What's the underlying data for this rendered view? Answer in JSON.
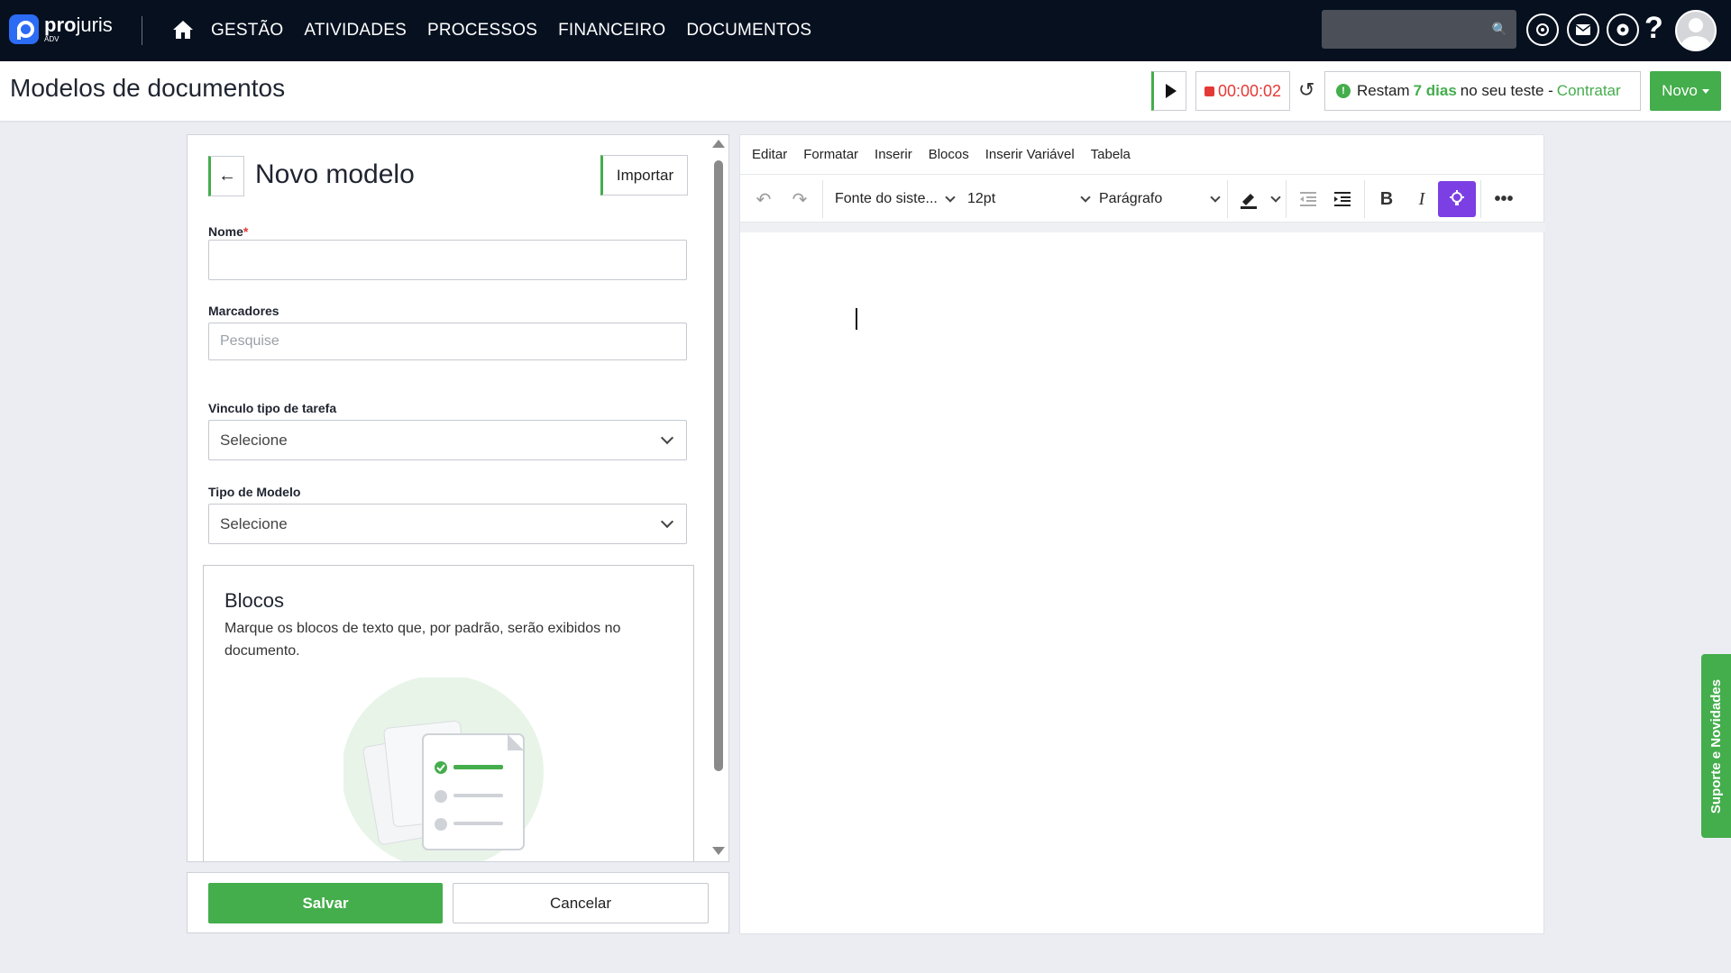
{
  "brand": {
    "name_bold": "pro",
    "name_light": "juris",
    "sub": "ADV"
  },
  "nav": {
    "links": [
      "GESTÃO",
      "ATIVIDADES",
      "PROCESSOS",
      "FINANCEIRO",
      "DOCUMENTOS"
    ],
    "search_placeholder": ""
  },
  "header": {
    "title": "Modelos de documentos",
    "timer": "00:00:02",
    "trial_prefix": "Restam",
    "trial_days": "7 dias",
    "trial_suffix": "no seu teste -",
    "trial_link": "Contratar",
    "novo_label": "Novo"
  },
  "form": {
    "title": "Novo modelo",
    "import_label": "Importar",
    "nome_label": "Nome",
    "required_mark": "*",
    "nome_value": "",
    "marcadores_label": "Marcadores",
    "marcadores_placeholder": "Pesquise",
    "vinculo_label": "Vinculo tipo de tarefa",
    "vinculo_value": "Selecione",
    "tipo_label": "Tipo de Modelo",
    "tipo_value": "Selecione",
    "blocos_title": "Blocos",
    "blocos_desc": "Marque os blocos de texto que, por padrão, serão exibidos no documento."
  },
  "actions": {
    "save_label": "Salvar",
    "cancel_label": "Cancelar"
  },
  "editor": {
    "menu": [
      "Editar",
      "Formatar",
      "Inserir",
      "Blocos",
      "Inserir Variável",
      "Tabela"
    ],
    "font_family": "Fonte do siste...",
    "font_size": "12pt",
    "block_format": "Parágrafo"
  },
  "side_tab": {
    "label": "Suporte e Novidades"
  },
  "colors": {
    "accent": "#44ad4c",
    "nav_bg": "#06101f",
    "ai_button": "#7b3fe4",
    "timer": "#e53935"
  }
}
